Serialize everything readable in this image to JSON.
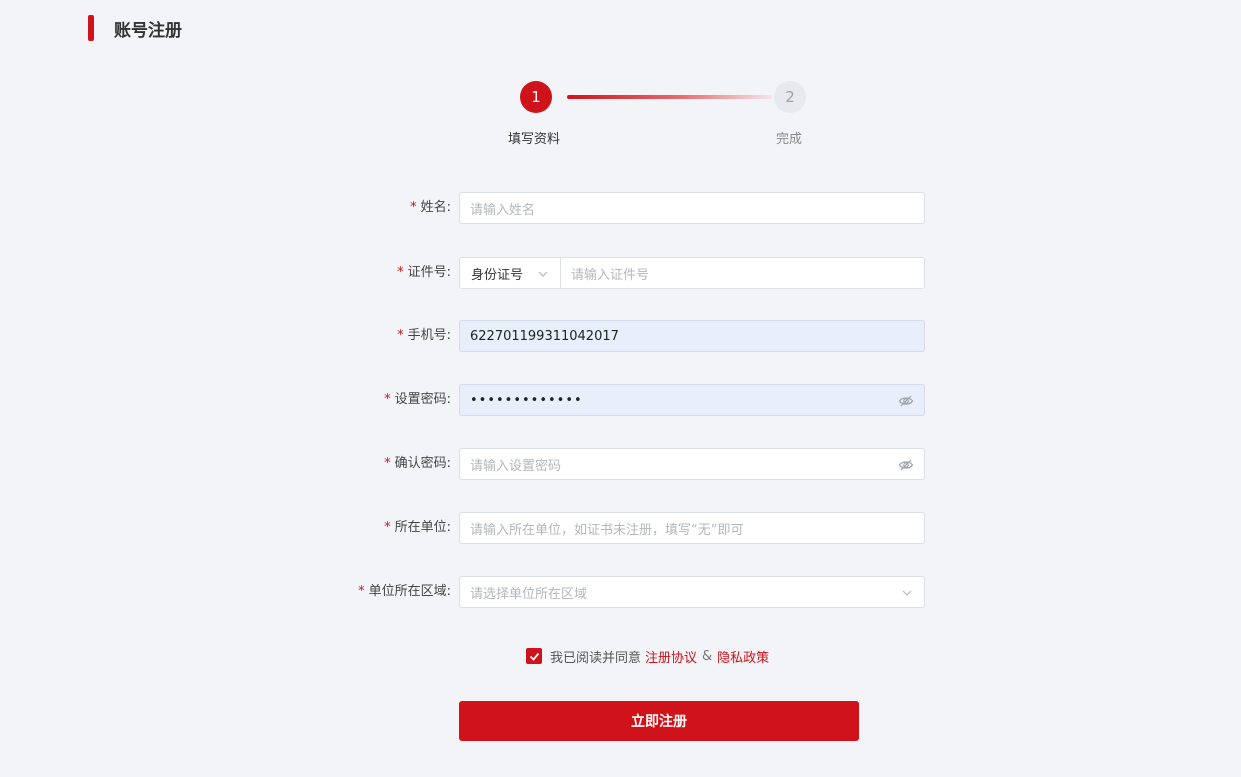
{
  "page": {
    "title": "账号注册"
  },
  "steps": [
    {
      "number": "1",
      "label": "填写资料",
      "state": "active"
    },
    {
      "number": "2",
      "label": "完成",
      "state": "pending"
    }
  ],
  "form": {
    "name": {
      "label": "姓名:",
      "placeholder": "请输入姓名"
    },
    "id_number": {
      "label": "证件号:",
      "type_value": "身份证号",
      "placeholder": "请输入证件号"
    },
    "phone": {
      "label": "手机号:",
      "value": "622701199311042017"
    },
    "password": {
      "label": "设置密码:",
      "value": "•••••••••••••"
    },
    "confirm_password": {
      "label": "确认密码:",
      "placeholder": "请输入设置密码"
    },
    "organization": {
      "label": "所在单位:",
      "placeholder": "请输入所在单位，如证书未注册，填写“无”即可"
    },
    "region": {
      "label": "单位所在区域:",
      "placeholder": "请选择单位所在区域"
    }
  },
  "agreement": {
    "text": "我已阅读并同意",
    "link1": "注册协议",
    "amp": "&",
    "link2": "隐私政策",
    "checked": true
  },
  "submit": {
    "label": "立即注册"
  },
  "colors": {
    "accent": "#d0121b",
    "background": "#f3f4f7",
    "filled_input": "#e8effb"
  },
  "icons": [
    "eye-hidden-icon",
    "chevron-down-icon",
    "check-icon"
  ]
}
